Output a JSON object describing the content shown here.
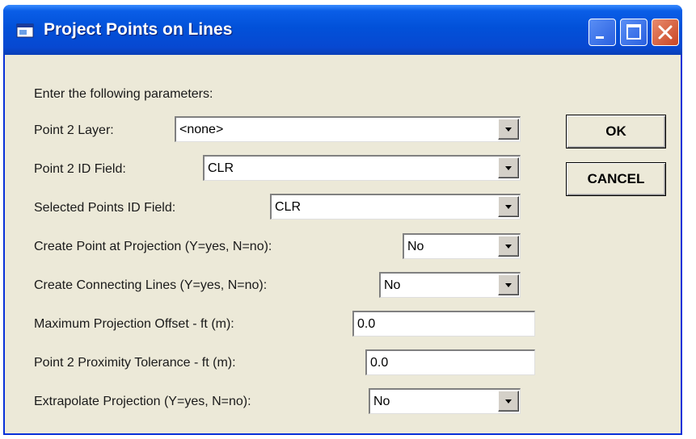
{
  "window": {
    "title": "Project Points on Lines",
    "titlebar_color": "#0251d9",
    "close_color": "#c84524",
    "icon": "window-app-icon"
  },
  "form": {
    "intro": "Enter the following parameters:",
    "fields": [
      {
        "label": "Point 2 Layer:",
        "value": "<none>",
        "type": "dropdown"
      },
      {
        "label": "Point 2 ID Field:",
        "value": "CLR",
        "type": "dropdown"
      },
      {
        "label": "Selected Points ID Field:",
        "value": "CLR",
        "type": "dropdown"
      },
      {
        "label": "Create Point at Projection (Y=yes, N=no):",
        "value": "No",
        "type": "dropdown"
      },
      {
        "label": "Create Connecting Lines (Y=yes, N=no):",
        "value": "No",
        "type": "dropdown"
      },
      {
        "label": "Maximum Projection Offset - ft (m):",
        "value": "0.0",
        "type": "text"
      },
      {
        "label": "Point 2 Proximity Tolerance - ft (m):",
        "value": "0.0",
        "type": "text"
      },
      {
        "label": "Extrapolate Projection (Y=yes, N=no):",
        "value": "No",
        "type": "dropdown"
      }
    ]
  },
  "buttons": {
    "ok": "OK",
    "cancel": "CANCEL"
  }
}
